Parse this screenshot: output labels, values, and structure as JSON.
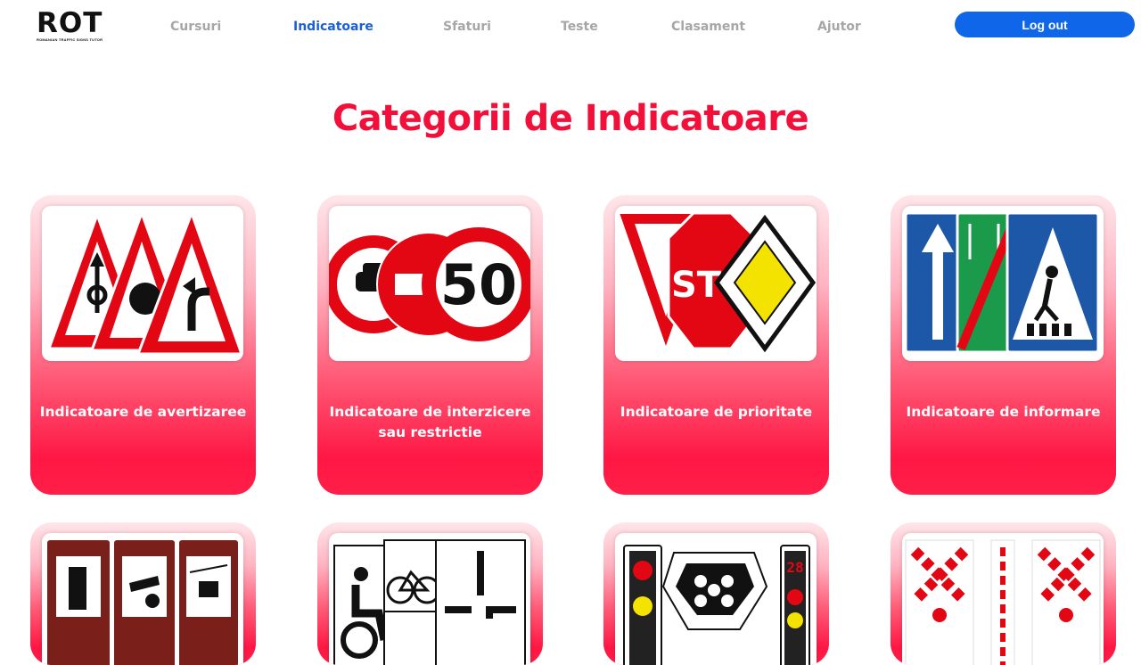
{
  "header": {
    "logo_text": "ROT",
    "logo_subtitle": "ROMANIAN TRAFFIC SIGNS TUTOR",
    "nav": [
      {
        "label": "Cursuri",
        "active": false
      },
      {
        "label": "Indicatoare",
        "active": true
      },
      {
        "label": "Sfaturi",
        "active": false
      },
      {
        "label": "Teste",
        "active": false
      },
      {
        "label": "Clasament",
        "active": false
      },
      {
        "label": "Ajutor",
        "active": false
      }
    ],
    "logout_label": "Log out"
  },
  "main": {
    "title": "Categorii de Indicatoare",
    "cards": [
      {
        "label": "Indicatoare de avertizaree",
        "image": "warning-signs-image"
      },
      {
        "label": "Indicatoare de interzicere sau restrictie",
        "image": "prohibition-signs-image"
      },
      {
        "label": "Indicatoare de prioritate",
        "image": "priority-signs-image"
      },
      {
        "label": "Indicatoare de informare",
        "image": "information-signs-image"
      },
      {
        "label": "",
        "image": "tourist-signs-image"
      },
      {
        "label": "",
        "image": "additional-panels-image"
      },
      {
        "label": "",
        "image": "traffic-lights-image"
      },
      {
        "label": "",
        "image": "railway-crossing-signs-image"
      }
    ],
    "sign_texts": {
      "speed_limit": "50",
      "stop": "STO",
      "counter": "28"
    }
  },
  "colors": {
    "accent_red": "#f20f3a",
    "nav_active": "#1c5fd6",
    "nav_inactive": "#a6a6a6",
    "logout_bg": "#0f66e8"
  }
}
